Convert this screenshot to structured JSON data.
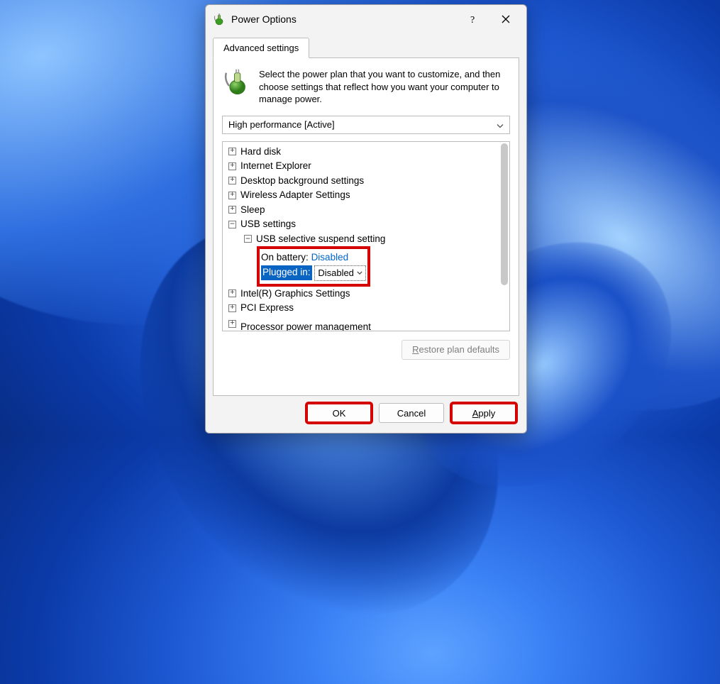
{
  "window": {
    "title": "Power Options",
    "help_tooltip": "Help",
    "close_tooltip": "Close"
  },
  "tabs": {
    "advanced": "Advanced settings"
  },
  "intro": "Select the power plan that you want to customize, and then choose settings that reflect how you want your computer to manage power.",
  "plan_selected": "High performance [Active]",
  "tree": {
    "hard_disk": "Hard disk",
    "ie": "Internet Explorer",
    "desktop_bg": "Desktop background settings",
    "wifi": "Wireless Adapter Settings",
    "sleep": "Sleep",
    "usb_settings": "USB settings",
    "usb_sel_suspend": "USB selective suspend setting",
    "on_battery_label": "On battery:",
    "on_battery_value": "Disabled",
    "plugged_in_label": "Plugged in:",
    "plugged_in_value": "Disabled",
    "intel_gfx": "Intel(R) Graphics Settings",
    "pci": "PCI Express",
    "proc_pm": "Processor power management"
  },
  "buttons": {
    "restore": "Restore plan defaults",
    "ok": "OK",
    "cancel": "Cancel",
    "apply": "Apply"
  }
}
